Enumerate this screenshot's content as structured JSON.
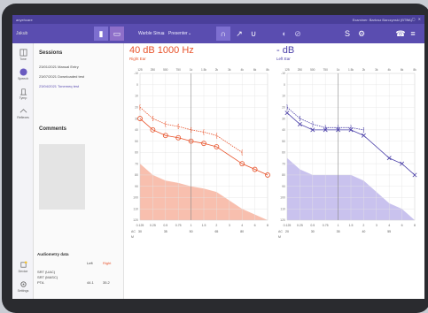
{
  "titlebar": {
    "app": "anyehcare",
    "examiner": "Examiner: Bartosz Barczynski (BTBA)",
    "window_controls": "– ▢ ✕"
  },
  "toolbar": {
    "user": "Jakub",
    "stimulus": "Warble Sinus",
    "presenter": "Presenter"
  },
  "sidebar": {
    "items": [
      "Tone",
      "Speech",
      "Tymp",
      "Reflexes",
      "Device",
      "Settings"
    ]
  },
  "sessions_panel": {
    "title": "Sessions",
    "sessions": [
      "23/01/2021 Manual Entry",
      "23/07/2021 Downloaded test",
      "23/04/2021 Tonemeq test"
    ],
    "comments_title": "Comments",
    "audiometry": {
      "title": "Audiometry data",
      "col_left": "Left",
      "col_right": "Right",
      "rows": [
        {
          "label": "SRT (UAC)",
          "left": "",
          "right": ""
        },
        {
          "label": "SRT (MASC)",
          "left": "",
          "right": ""
        },
        {
          "label": "PTA",
          "left": "44.1",
          "right": "35.2"
        }
      ]
    }
  },
  "right_ear": {
    "title": "40 dB  1000 Hz",
    "subtitle": "Right Ear",
    "color": "#e8532b"
  },
  "left_ear": {
    "title": "- dB",
    "subtitle": "Left Ear",
    "color": "#4a3fa8"
  },
  "chart_data": [
    {
      "type": "line",
      "title": "40 dB  1000 Hz",
      "subtitle": "Right Ear",
      "x": [
        "0.125",
        "0.25",
        "0.5",
        "0.75",
        "1",
        "1.5",
        "2",
        "3",
        "4",
        "6",
        "8"
      ],
      "x_top": [
        "125",
        "250",
        "500",
        "750",
        "1k",
        "1.5k",
        "2k",
        "3k",
        "4k",
        "6k",
        "8k"
      ],
      "ylim": [
        -10,
        120
      ],
      "y_ticks": [
        -10,
        0,
        10,
        20,
        30,
        40,
        50,
        60,
        70,
        80,
        90,
        100,
        110,
        120
      ],
      "series": [
        {
          "name": "AC",
          "values": [
            30,
            40,
            45,
            47,
            50,
            52,
            55,
            null,
            70,
            75,
            80
          ]
        },
        {
          "name": "BC",
          "values": [
            20,
            30,
            35,
            37,
            40,
            42,
            45,
            null,
            60,
            null,
            null
          ]
        }
      ],
      "bottom_rows": [
        {
          "label": "AC",
          "values": [
            "30",
            "",
            "35",
            "",
            "50",
            "",
            "65",
            "",
            "80",
            "",
            ""
          ]
        },
        {
          "label": "M",
          "values": [
            "",
            "",
            "",
            "",
            "",
            "",
            "",
            "",
            "",
            "",
            ""
          ]
        }
      ]
    },
    {
      "type": "line",
      "title": "- dB",
      "subtitle": "Left Ear",
      "x": [
        "0.125",
        "0.25",
        "0.5",
        "0.75",
        "1",
        "1.5",
        "2",
        "3",
        "4",
        "6",
        "8"
      ],
      "x_top": [
        "125",
        "250",
        "500",
        "750",
        "1k",
        "1.5k",
        "2k",
        "3k",
        "4k",
        "6k",
        "8k"
      ],
      "ylim": [
        -10,
        120
      ],
      "y_ticks": [
        -10,
        0,
        10,
        20,
        30,
        40,
        50,
        60,
        70,
        80,
        90,
        100,
        110,
        120
      ],
      "series": [
        {
          "name": "AC",
          "values": [
            25,
            35,
            40,
            40,
            40,
            40,
            45,
            null,
            65,
            70,
            80
          ]
        },
        {
          "name": "BC",
          "values": [
            20,
            30,
            35,
            38,
            38,
            38,
            40,
            null,
            null,
            null,
            null
          ]
        }
      ],
      "bottom_rows": [
        {
          "label": "AC",
          "values": [
            "20",
            "",
            "30",
            "",
            "35",
            "",
            "40",
            "",
            "55",
            "",
            ""
          ]
        },
        {
          "label": "M",
          "values": [
            "",
            "",
            "",
            "",
            "",
            "",
            "",
            "",
            "",
            "",
            ""
          ]
        }
      ]
    }
  ]
}
